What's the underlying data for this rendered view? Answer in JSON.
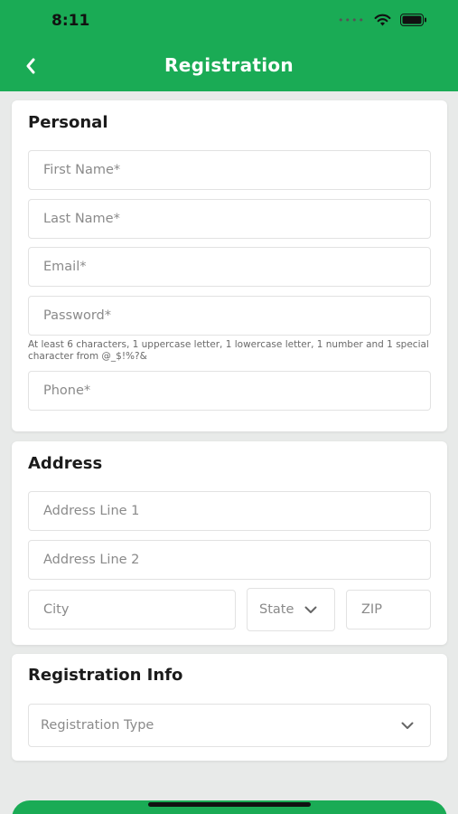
{
  "status_bar": {
    "time": "8:11"
  },
  "header": {
    "title": "Registration"
  },
  "personal": {
    "title": "Personal",
    "first_name": "First Name*",
    "last_name": "Last Name*",
    "email": "Email*",
    "password": "Password*",
    "password_hint": "At least 6 characters, 1 uppercase letter, 1 lowercase letter, 1 number and 1 special character from @_$!%?&",
    "phone": "Phone*"
  },
  "address": {
    "title": "Address",
    "line1": "Address Line 1",
    "line2": "Address Line 2",
    "city": "City",
    "state": "State",
    "zip": "ZIP"
  },
  "registration_info": {
    "title": "Registration Info",
    "type": "Registration Type"
  },
  "colors": {
    "accent": "#1aab55"
  },
  "icons": [
    "back-chevron-icon",
    "wifi-icon",
    "battery-icon",
    "chevron-down-icon"
  ]
}
